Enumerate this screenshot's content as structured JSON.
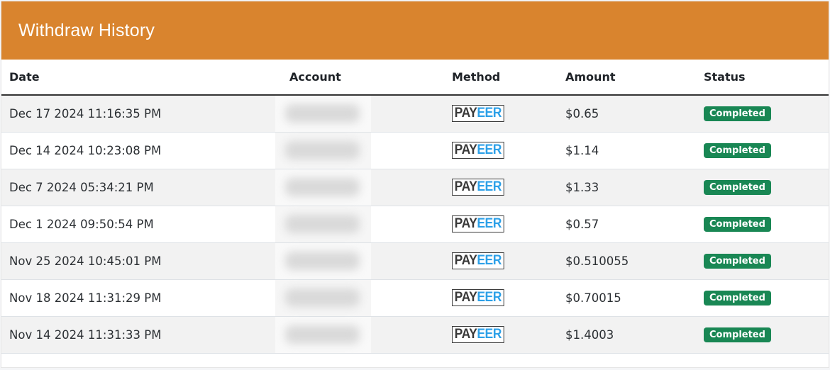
{
  "header": {
    "title": "Withdraw History"
  },
  "colors": {
    "header_bg": "#d9842e",
    "badge_bg": "#198754",
    "payeer_blue": "#2ca0e8"
  },
  "table": {
    "columns": [
      "Date",
      "Account",
      "Method",
      "Amount",
      "Status"
    ],
    "rows": [
      {
        "date": "Dec 17 2024 11:16:35 PM",
        "method": "PAYEER",
        "amount": "$0.65",
        "status": "Completed"
      },
      {
        "date": "Dec 14 2024 10:23:08 PM",
        "method": "PAYEER",
        "amount": "$1.14",
        "status": "Completed"
      },
      {
        "date": "Dec 7 2024 05:34:21 PM",
        "method": "PAYEER",
        "amount": "$1.33",
        "status": "Completed"
      },
      {
        "date": "Dec 1 2024 09:50:54 PM",
        "method": "PAYEER",
        "amount": "$0.57",
        "status": "Completed"
      },
      {
        "date": "Nov 25 2024 10:45:01 PM",
        "method": "PAYEER",
        "amount": "$0.510055",
        "status": "Completed"
      },
      {
        "date": "Nov 18 2024 11:31:29 PM",
        "method": "PAYEER",
        "amount": "$0.70015",
        "status": "Completed"
      },
      {
        "date": "Nov 14 2024 11:31:33 PM",
        "method": "PAYEER",
        "amount": "$1.4003",
        "status": "Completed"
      }
    ]
  }
}
